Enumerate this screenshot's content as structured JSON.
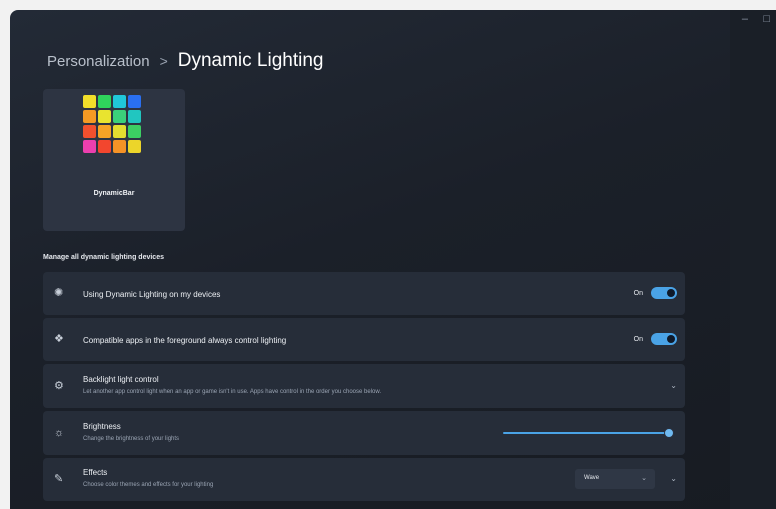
{
  "breadcrumb": {
    "parent": "Personalization",
    "separator": ">",
    "current": "Dynamic Lighting"
  },
  "device": {
    "name": "DynamicBar",
    "led_colors": [
      "#f2df2a",
      "#2fd45c",
      "#20c7d9",
      "#2a6ff0",
      "#f59a24",
      "#e9e42f",
      "#3bd07a",
      "#21c6c0",
      "#f2502e",
      "#f6a326",
      "#e3dd30",
      "#3ccf63",
      "#ec3fae",
      "#f2462e",
      "#f59226",
      "#ecd52a"
    ]
  },
  "section_label": "Manage all dynamic lighting devices",
  "rows": [
    {
      "icon": "sun-icon",
      "title": "Using Dynamic Lighting on my devices",
      "toggle_text": "On",
      "toggle_on": true
    },
    {
      "icon": "apps-icon",
      "title": "Compatible apps in the foreground always control lighting",
      "toggle_text": "On",
      "toggle_on": true
    },
    {
      "icon": "gear-icon",
      "title": "Backlight light control",
      "description": "Let another app control light when an app or game isn't in use. Apps have control in the order you choose below."
    },
    {
      "icon": "brightness-icon",
      "title": "Brightness",
      "description": "Change the brightness of your lights",
      "value": 1.0
    },
    {
      "icon": "brush-icon",
      "title": "Effects",
      "description": "Choose color themes and effects for your lighting",
      "select_value": "Wave"
    }
  ]
}
